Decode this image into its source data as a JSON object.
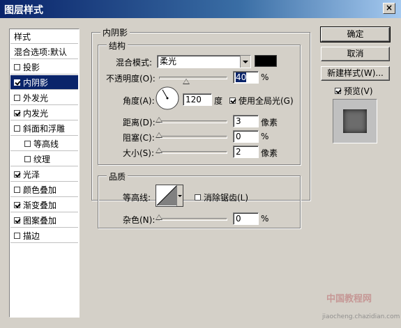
{
  "window": {
    "title": "图层样式",
    "close": "×"
  },
  "style_list": {
    "header": "样式",
    "items": [
      {
        "label": "混合选项:默认",
        "checkbox": false,
        "checked": false,
        "selected": false,
        "indent": false
      },
      {
        "label": "投影",
        "checkbox": true,
        "checked": false,
        "selected": false,
        "indent": false
      },
      {
        "label": "内阴影",
        "checkbox": true,
        "checked": true,
        "selected": true,
        "indent": false
      },
      {
        "label": "外发光",
        "checkbox": true,
        "checked": false,
        "selected": false,
        "indent": false
      },
      {
        "label": "内发光",
        "checkbox": true,
        "checked": true,
        "selected": false,
        "indent": false
      },
      {
        "label": "斜面和浮雕",
        "checkbox": true,
        "checked": false,
        "selected": false,
        "indent": false
      },
      {
        "label": "等高线",
        "checkbox": true,
        "checked": false,
        "selected": false,
        "indent": true
      },
      {
        "label": "纹理",
        "checkbox": true,
        "checked": false,
        "selected": false,
        "indent": true
      },
      {
        "label": "光泽",
        "checkbox": true,
        "checked": true,
        "selected": false,
        "indent": false
      },
      {
        "label": "颜色叠加",
        "checkbox": true,
        "checked": false,
        "selected": false,
        "indent": false
      },
      {
        "label": "渐变叠加",
        "checkbox": true,
        "checked": true,
        "selected": false,
        "indent": false
      },
      {
        "label": "图案叠加",
        "checkbox": true,
        "checked": true,
        "selected": false,
        "indent": false
      },
      {
        "label": "描边",
        "checkbox": true,
        "checked": false,
        "selected": false,
        "indent": false
      }
    ]
  },
  "panel": {
    "title": "内阴影",
    "structure": {
      "title": "结构",
      "blend_mode_label": "混合模式:",
      "blend_mode_value": "柔光",
      "blend_color": "#000000",
      "opacity_label": "不透明度(O):",
      "opacity_value": "40",
      "opacity_fraction": 0.4,
      "percent": "%",
      "angle_label": "角度(A):",
      "angle_value": "120",
      "angle_unit": "度",
      "global_light_label": "使用全局光(G)",
      "global_light_checked": true,
      "distance_label": "距离(D):",
      "distance_value": "3",
      "distance_fraction": 0.0,
      "choke_label": "阻塞(C):",
      "choke_value": "0",
      "choke_fraction": 0.0,
      "size_label": "大小(S):",
      "size_value": "2",
      "size_fraction": 0.0,
      "pixels": "像素"
    },
    "quality": {
      "title": "品质",
      "contour_label": "等高线:",
      "anti_alias_label": "消除锯齿(L)",
      "anti_alias_checked": false,
      "noise_label": "杂色(N):",
      "noise_value": "0",
      "noise_fraction": 0.0
    }
  },
  "buttons": {
    "ok": "确定",
    "cancel": "取消",
    "new_style": "新建样式(W)...",
    "preview_label": "预览(V)",
    "preview_checked": true
  },
  "watermark": {
    "line1": "中国教程网",
    "line2": "jiaocheng.chazidian.com"
  }
}
